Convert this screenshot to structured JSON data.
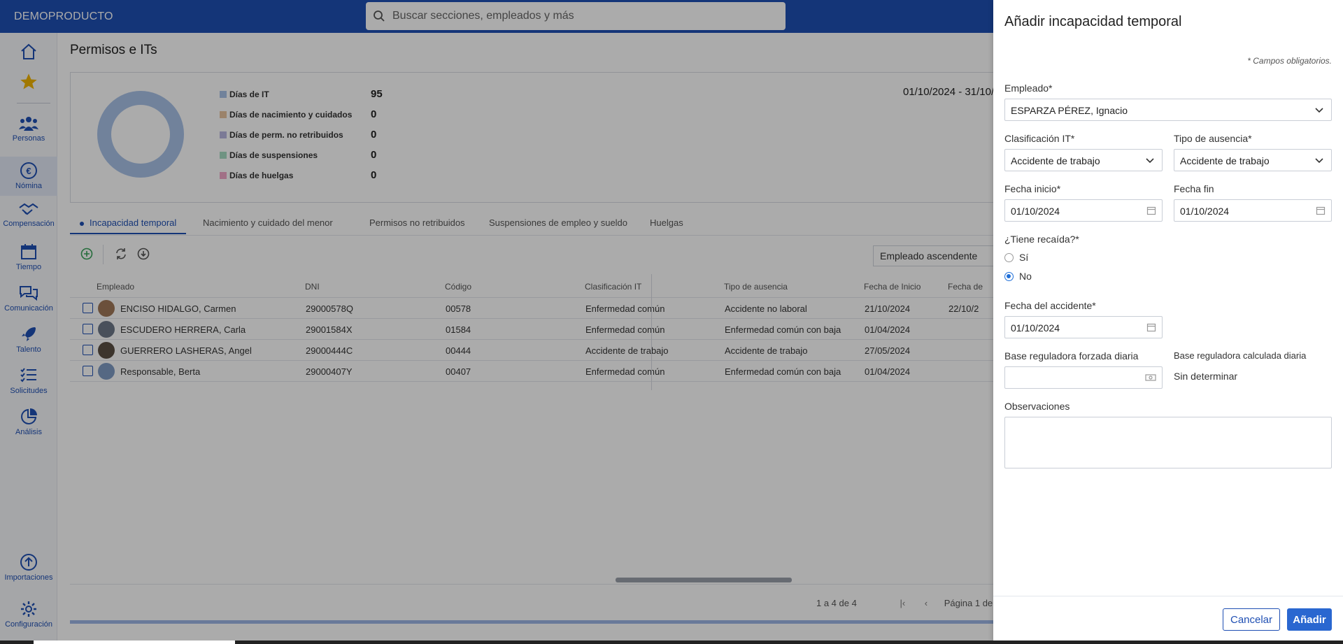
{
  "app": {
    "brand": "DEMOPRODUCTO",
    "search_placeholder": "Buscar secciones, empleados y más"
  },
  "sidebar": {
    "items": [
      {
        "label": "",
        "icon": "home-icon"
      },
      {
        "label": "",
        "icon": "star-icon"
      },
      {
        "label": "Personas",
        "icon": "people-icon"
      },
      {
        "label": "Nómina",
        "icon": "euro-icon"
      },
      {
        "label": "Compensación",
        "icon": "handshake-icon"
      },
      {
        "label": "Tiempo",
        "icon": "calendar-icon"
      },
      {
        "label": "Comunicación",
        "icon": "chat-icon"
      },
      {
        "label": "Talento",
        "icon": "rocket-icon"
      },
      {
        "label": "Solicitudes",
        "icon": "checklist-icon"
      },
      {
        "label": "Análisis",
        "icon": "pie-icon"
      },
      {
        "label": "Importaciones",
        "icon": "upload-icon"
      },
      {
        "label": "Configuración",
        "icon": "gear-icon"
      }
    ]
  },
  "page": {
    "title": "Permisos e ITs",
    "date_range": "01/10/2024 - 31/10/",
    "legend": [
      {
        "label": "Días de IT",
        "value": "95",
        "color": "#a9c2e8"
      },
      {
        "label": "Días de nacimiento y cuidados",
        "value": "0",
        "color": "#e8c4a0"
      },
      {
        "label": "Días de perm. no retribuidos",
        "value": "0",
        "color": "#b8b6e0"
      },
      {
        "label": "Días de suspensiones",
        "value": "0",
        "color": "#a6dcc2"
      },
      {
        "label": "Días de huelgas",
        "value": "0",
        "color": "#f0a8c8"
      }
    ],
    "tabs": [
      "Incapacidad temporal",
      "Nacimiento y cuidado del menor",
      "Permisos no retribuidos",
      "Suspensiones de empleo y sueldo",
      "Huelgas"
    ],
    "sort_value": "Empleado ascendente",
    "columns": [
      "Empleado",
      "DNI",
      "Código",
      "Clasificación IT",
      "Tipo de ausencia",
      "Fecha de Inicio",
      "Fecha de"
    ],
    "rows": [
      [
        "ENCISO HIDALGO, Carmen",
        "29000578Q",
        "00578",
        "Enfermedad común",
        "Accidente no laboral",
        "21/10/2024",
        "22/10/2"
      ],
      [
        "ESCUDERO HERRERA, Carla",
        "29001584X",
        "01584",
        "Enfermedad común",
        "Enfermedad común con baja",
        "01/04/2024",
        ""
      ],
      [
        "GUERRERO LASHERAS, Angel",
        "29000444C",
        "00444",
        "Accidente de trabajo",
        "Accidente de trabajo",
        "27/05/2024",
        ""
      ],
      [
        "Responsable, Berta",
        "29000407Y",
        "00407",
        "Enfermedad común",
        "Enfermedad común con baja",
        "01/04/2024",
        ""
      ]
    ],
    "pager_count": "1 a 4 de 4",
    "pager_page": "Página 1 de"
  },
  "panel": {
    "title": "Añadir incapacidad temporal",
    "required_note": "* Campos obligatorios.",
    "employee_label": "Empleado*",
    "employee_value": "ESPARZA PÉREZ, Ignacio",
    "clasificacion_label": "Clasificación IT*",
    "clasificacion_value": "Accidente de trabajo",
    "tipo_label": "Tipo de ausencia*",
    "tipo_value": "Accidente de trabajo",
    "inicio_label": "Fecha inicio*",
    "inicio_value": "01/10/2024",
    "fin_label": "Fecha fin",
    "fin_value": "01/10/2024",
    "recaida_label": "¿Tiene recaída?*",
    "recaida_si": "Sí",
    "recaida_no": "No",
    "accidente_label": "Fecha del accidente*",
    "accidente_value": "01/10/2024",
    "base_forzada_label": "Base reguladora forzada diaria",
    "base_forzada_value": "",
    "base_calculada_label": "Base reguladora calculada diaria",
    "base_calculada_value": "Sin determinar",
    "observaciones_label": "Observaciones",
    "cancel": "Cancelar",
    "add": "Añadir"
  }
}
